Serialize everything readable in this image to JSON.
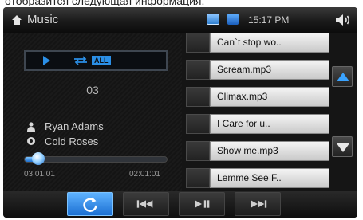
{
  "caption": "отобразится следующая информация:",
  "topbar": {
    "title": "Music",
    "clock": "15:17 PM",
    "icons": [
      "home-icon",
      "picture-icon",
      "folder-icon",
      "volume-icon"
    ]
  },
  "now_playing": {
    "mode_badge": "ALL",
    "track_number": "03",
    "artist": "Ryan Adams",
    "album": "Cold Roses",
    "time_elapsed": "03:01:01",
    "time_total": "02:01:01",
    "progress_fraction": 0.1
  },
  "playlist": {
    "items": [
      "Can`t stop wo..",
      "Scream.mp3",
      "Climax.mp3",
      "I Care for u..",
      "Show me.mp3",
      "Lemme See F.."
    ]
  },
  "controls": {
    "buttons": [
      "repeat-icon",
      "previous-icon",
      "play-pause-icon",
      "next-icon"
    ],
    "active_index": 0
  },
  "colors": {
    "accent": "#2b8fe6",
    "background": "#151515",
    "playlist_item": "#e0e0e0"
  }
}
